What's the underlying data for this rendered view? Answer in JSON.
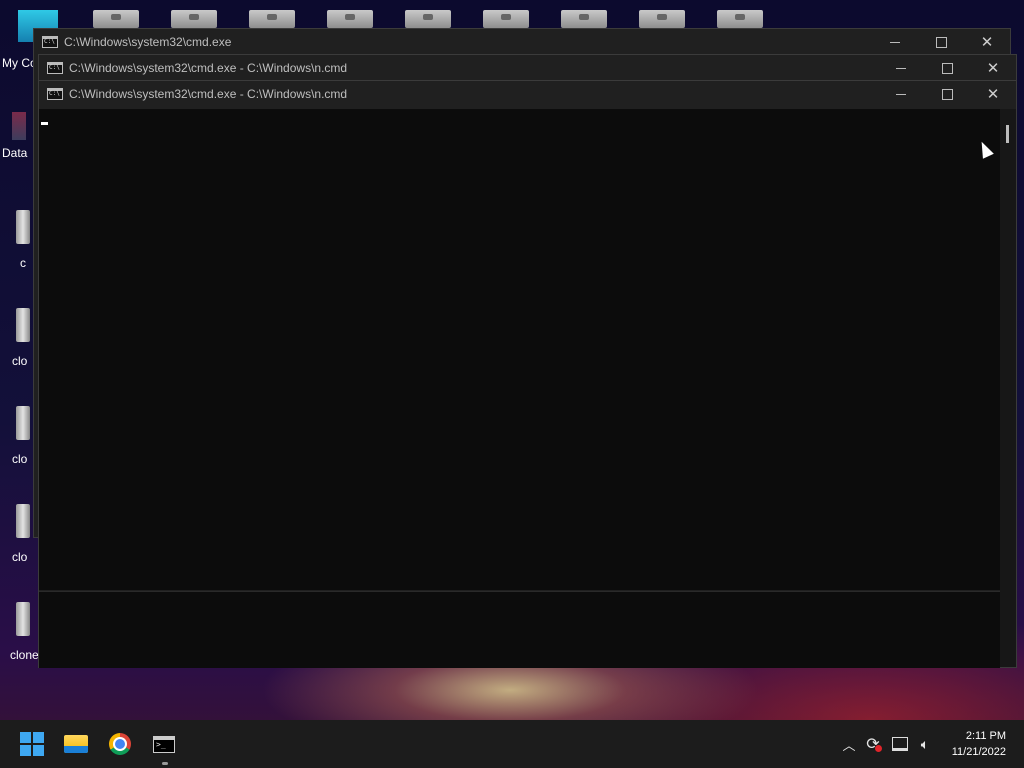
{
  "desktop": {
    "icons": [
      {
        "label": "My Co"
      },
      {
        "label": "Data"
      },
      {
        "label": "c"
      },
      {
        "label": "clo"
      },
      {
        "label": "clo"
      },
      {
        "label": "clo"
      },
      {
        "label": "clone"
      }
    ]
  },
  "windows": [
    {
      "title": "C:\\Windows\\system32\\cmd.exe"
    },
    {
      "title": "C:\\Windows\\system32\\cmd.exe - C:\\Windows\\n.cmd"
    },
    {
      "title": "C:\\Windows\\system32\\cmd.exe - C:\\Windows\\n.cmd"
    }
  ],
  "window_controls": {
    "minimize": "minimize",
    "maximize": "maximize",
    "close": "✕"
  },
  "taskbar": {
    "apps": [
      "start-icon",
      "file-explorer-icon",
      "chrome-icon",
      "cmd-icon"
    ],
    "tray": [
      "chevron-up-icon",
      "sync-icon",
      "network-icon",
      "volume-icon"
    ],
    "clock": {
      "time": "2:11 PM",
      "date": "11/21/2022"
    }
  },
  "colors": {
    "accent": "#3ea8f2",
    "console_bg": "#0c0c0c",
    "title_bg": "#202020"
  }
}
